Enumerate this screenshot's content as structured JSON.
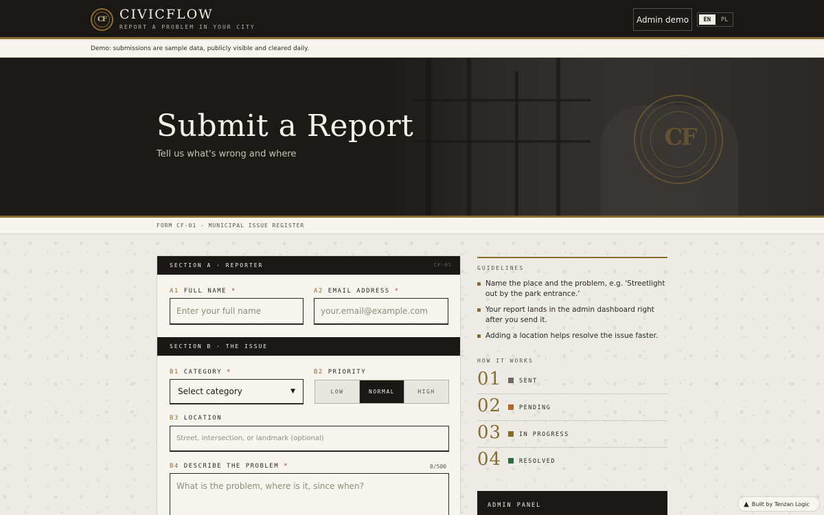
{
  "brand": {
    "seal_text": "CF",
    "name": "CIVICFLOW",
    "tagline": "REPORT A PROBLEM IN YOUR CITY"
  },
  "header": {
    "admin_label": "Admin demo",
    "lang": [
      "EN",
      "PL"
    ],
    "active_lang": "EN"
  },
  "notice": "Demo: submissions are sample data, publicly visible and cleared daily.",
  "hero": {
    "title": "Submit a Report",
    "subtitle": "Tell us what's wrong and where",
    "seal_text": "CF"
  },
  "form_code": "FORM CF-01 · MUNICIPAL ISSUE REGISTER",
  "form": {
    "section_a": {
      "title": "SECTION A · REPORTER",
      "code": "CF-01"
    },
    "full_name": {
      "num": "A1",
      "label": "FULL NAME",
      "req": "*",
      "placeholder": "Enter your full name"
    },
    "email": {
      "num": "A2",
      "label": "EMAIL ADDRESS",
      "req": "*",
      "placeholder": "your.email@example.com"
    },
    "section_b": {
      "title": "SECTION B · THE ISSUE"
    },
    "category": {
      "num": "B1",
      "label": "CATEGORY",
      "req": "*",
      "value": "Select category"
    },
    "priority": {
      "num": "B2",
      "label": "PRIORITY",
      "options": [
        "LOW",
        "NORMAL",
        "HIGH"
      ],
      "selected": "NORMAL"
    },
    "location": {
      "num": "B3",
      "label": "LOCATION",
      "placeholder": "Street, intersection, or landmark (optional)"
    },
    "describe": {
      "num": "B4",
      "label": "DESCRIBE THE PROBLEM",
      "req": "*",
      "counter": "0/500",
      "placeholder": "What is the problem, where is it, since when?"
    }
  },
  "guidelines": {
    "title": "GUIDELINES",
    "items": [
      "Name the place and the problem, e.g. 'Streetlight out by the park entrance.'",
      "Your report lands in the admin dashboard right after you send it.",
      "Adding a location helps resolve the issue faster."
    ]
  },
  "how_it_works": {
    "title": "HOW IT WORKS",
    "steps": [
      {
        "num": "01",
        "label": "SENT",
        "color": "#6e6a60"
      },
      {
        "num": "02",
        "label": "PENDING",
        "color": "#b5652a"
      },
      {
        "num": "03",
        "label": "IN PROGRESS",
        "color": "#8a6d2d"
      },
      {
        "num": "04",
        "label": "RESOLVED",
        "color": "#2f6b3c"
      }
    ]
  },
  "admin_panel": {
    "title": "ADMIN PANEL"
  },
  "footer_badge": "Built by Tenzan Logic",
  "colors": {
    "accent": "#8a6d2d",
    "dark": "#1a1815",
    "paper": "#f7f5ee",
    "required": "#b23a2e"
  }
}
